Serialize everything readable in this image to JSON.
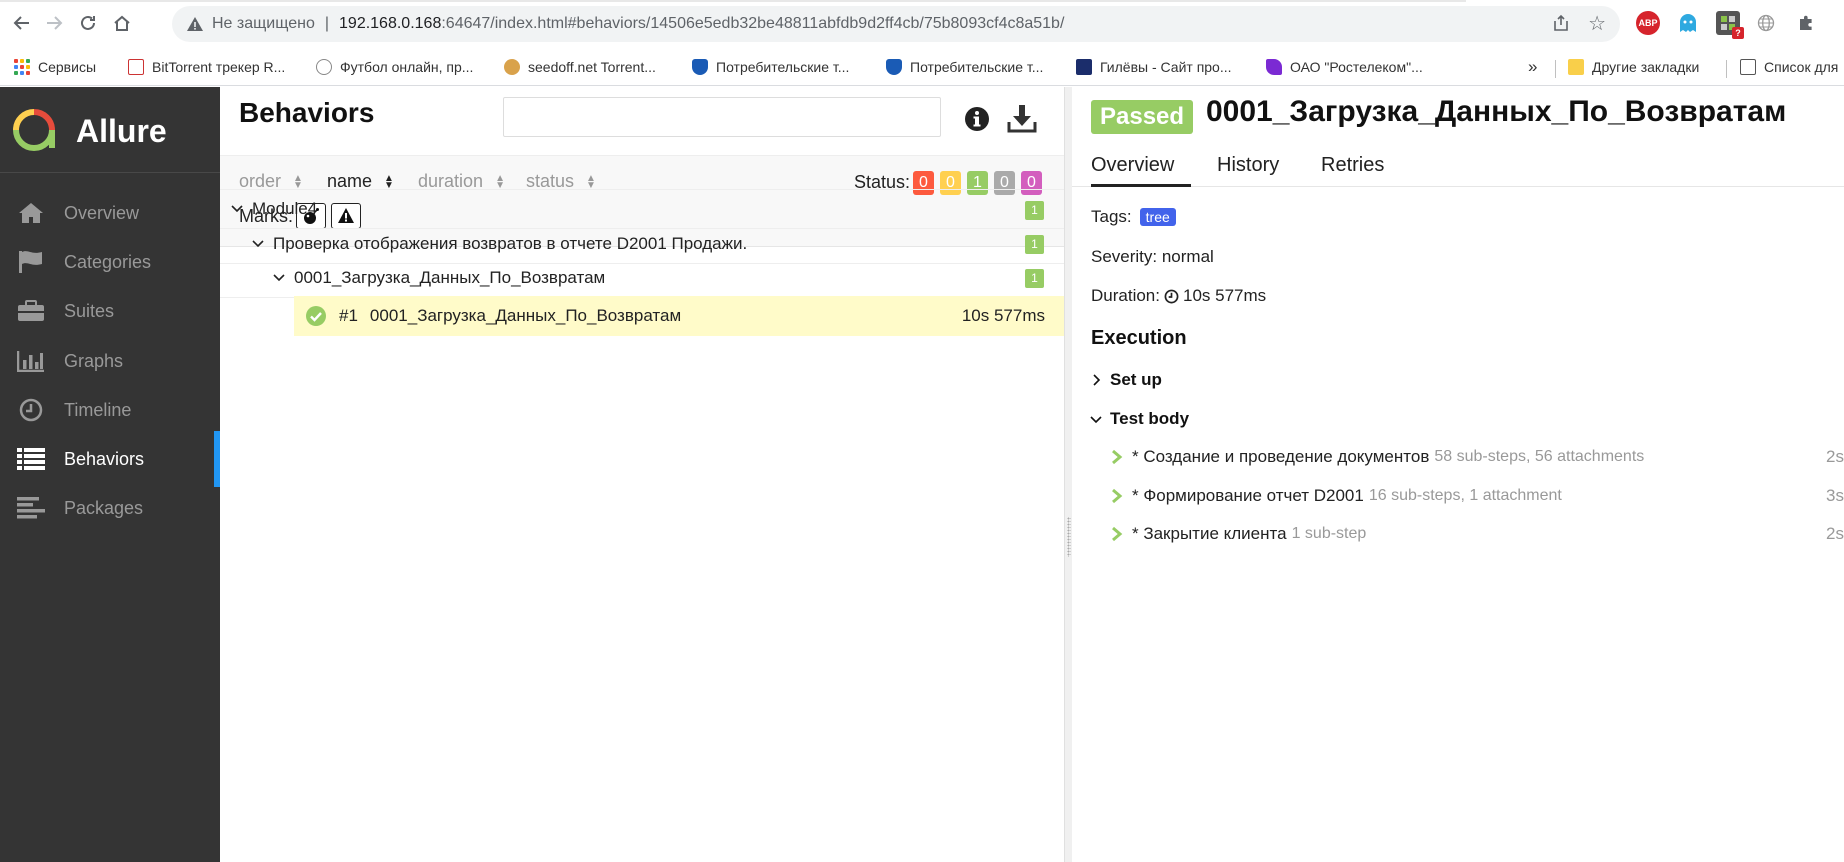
{
  "browser": {
    "omnibox": {
      "security_label": "Не защищено",
      "separator": "|",
      "url_host": "192.168.0.168",
      "url_rest": ":64647/index.html#behaviors/14506e5edb32be48811abfdb9d2ff4cb/75b8093cf4c8a51b/"
    },
    "extensions": {
      "abp_label": "ABP",
      "badge_count": "?"
    },
    "bookmarks": [
      {
        "label": "Сервисы"
      },
      {
        "label": "BitTorrent трекер R..."
      },
      {
        "label": "Футбол онлайн, пр..."
      },
      {
        "label": "seedoff.net Torrent..."
      },
      {
        "label": "Потребительские т..."
      },
      {
        "label": "Потребительские т..."
      },
      {
        "label": "Гилёвы - Сайт про..."
      },
      {
        "label": "ОАО \"Ростелеком\"..."
      }
    ],
    "overflow": "»",
    "other_bookmarks": "Другие закладки",
    "reading_list": "Список для"
  },
  "sidebar": {
    "brand": "Allure",
    "items": [
      {
        "label": "Overview",
        "icon": "home-icon"
      },
      {
        "label": "Categories",
        "icon": "flag-icon"
      },
      {
        "label": "Suites",
        "icon": "briefcase-icon"
      },
      {
        "label": "Graphs",
        "icon": "bar-chart-icon"
      },
      {
        "label": "Timeline",
        "icon": "clock-icon"
      },
      {
        "label": "Behaviors",
        "icon": "list-icon",
        "active": true
      },
      {
        "label": "Packages",
        "icon": "align-left-icon"
      }
    ]
  },
  "behaviors": {
    "title": "Behaviors",
    "search_placeholder": "",
    "sort": {
      "order": "order",
      "name": "name",
      "duration": "duration",
      "status": "status"
    },
    "status_label": "Status:",
    "status_counts": [
      {
        "value": "0",
        "color": "#fd5a3e"
      },
      {
        "value": "0",
        "color": "#ffd050"
      },
      {
        "value": "1",
        "color": "#97cc64"
      },
      {
        "value": "0",
        "color": "#aaaaaa"
      },
      {
        "value": "0",
        "color": "#d35ebe"
      }
    ],
    "marks_label": "Marks:",
    "tree": {
      "feature": {
        "label": "Module4",
        "count": "1"
      },
      "story": {
        "label": "Проверка отображения возвратов в отчете D2001 Продажи.",
        "count": "1"
      },
      "case": {
        "label": "0001_Загрузка_Данных_По_Возвратам",
        "count": "1"
      },
      "leaf": {
        "number": "#1",
        "label": "0001_Загрузка_Данных_По_Возвратам",
        "duration": "10s 577ms"
      }
    }
  },
  "testresult": {
    "status": "Passed",
    "title": "0001_Загрузка_Данных_По_Возвратам",
    "tabs": [
      "Overview",
      "History",
      "Retries"
    ],
    "tags_label": "Tags:",
    "tag": "tree",
    "severity_label": "Severity: normal",
    "duration_label": "Duration:",
    "duration_value": "10s 577ms",
    "execution_title": "Execution",
    "setup_label": "Set up",
    "testbody_label": "Test body",
    "steps": [
      {
        "name": "* Создание и проведение документов",
        "meta": "58 sub-steps, 56 attachments",
        "duration": "2s"
      },
      {
        "name": "* Формирование отчет D2001",
        "meta": "16 sub-steps, 1 attachment",
        "duration": "3s"
      },
      {
        "name": "* Закрытие клиента",
        "meta": "1 sub-step",
        "duration": "2s"
      }
    ]
  }
}
